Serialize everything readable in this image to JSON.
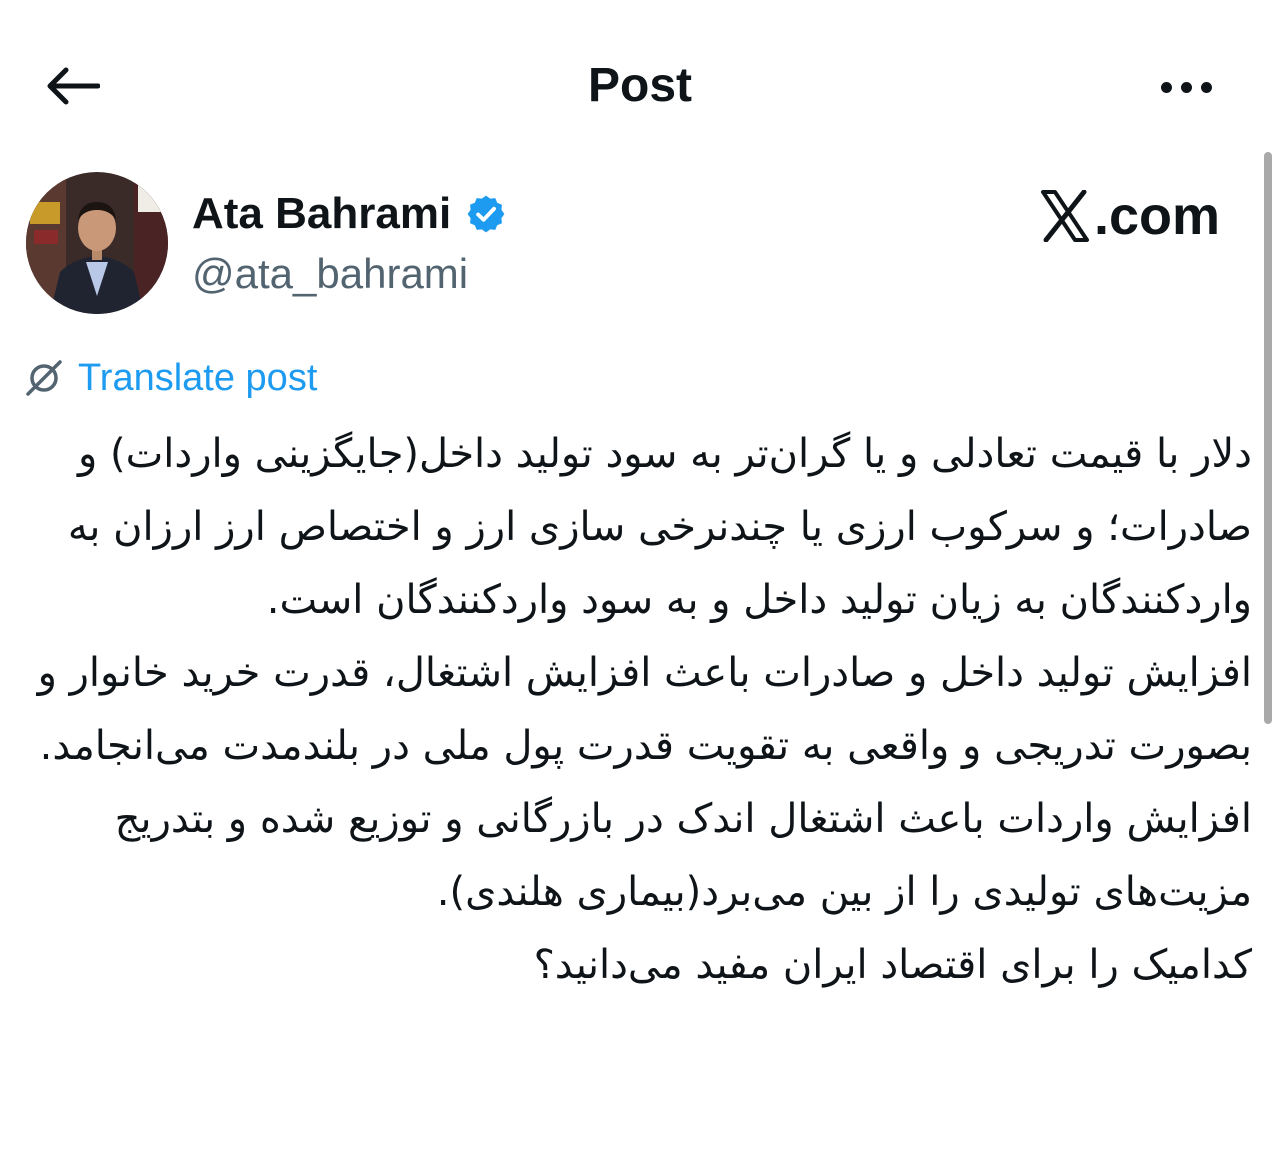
{
  "header": {
    "title": "Post",
    "back_icon": "arrow-left-icon",
    "more_icon": "more-horizontal-icon"
  },
  "author": {
    "name": "Ata Bahrami",
    "handle": "@ata_bahrami",
    "verified": true,
    "verified_badge_color": "#1d9bf0"
  },
  "brand": {
    "text": ".com"
  },
  "translate": {
    "label": "Translate post",
    "icon": "translate-icon",
    "color": "#1d9bf0"
  },
  "post": {
    "paragraphs": [
      "دلار با قیمت تعادلی و یا گران‌تر به سود تولید داخل(جایگزینی واردات) و صادرات؛ و سرکوب ارزی یا چندنرخی سازی ارز و اختصاص ارز ارزان به واردکنندگان به زیان تولید داخل و به سود واردکنندگان است.",
      "افزایش تولید داخل و صادرات باعث افزایش اشتغال، قدرت خرید خانوار و بصورت تدریجی و واقعی به تقویت قدرت پول ملی در بلندمدت می‌انجامد.",
      "افزایش واردات باعث اشتغال اندک در بازرگانی و توزیع شده و بتدریج مزیت‌های تولیدی را از بین می‌برد(بیماری هلندی).",
      "کدامیک را برای اقتصاد ایران مفید می‌دانید؟"
    ]
  }
}
